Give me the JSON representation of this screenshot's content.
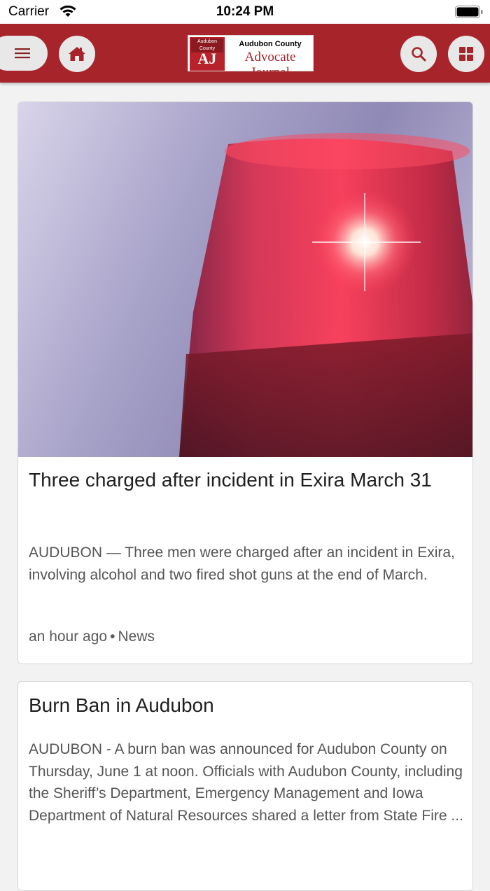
{
  "status_bar": {
    "carrier": "Carrier",
    "time": "10:24 PM"
  },
  "header": {
    "brand_color": "#a7242a",
    "logo": {
      "mark_top": "Audubon County",
      "mark_letters": "AJ",
      "line1": "Audubon County",
      "line2": "Advocate Journal"
    },
    "icons": [
      "menu-icon",
      "home-icon",
      "search-icon",
      "grid-icon"
    ]
  },
  "articles": [
    {
      "title": "Three charged after incident in Exira March 31",
      "excerpt": "AUDUBON — Three men were charged after an incident in Exira, involving alcohol and two fired shot guns at the end of March.",
      "time_ago": "an hour ago",
      "category": "News"
    },
    {
      "title": "Burn Ban in Audubon",
      "excerpt": "AUDUBON - A burn ban was announced for Audubon County on Thursday, June 1 at noon. Officials with Audubon County, including the Sheriff’s Department, Emergency Management and Iowa Department of Natural Resources shared a letter from State Fire ..."
    }
  ]
}
